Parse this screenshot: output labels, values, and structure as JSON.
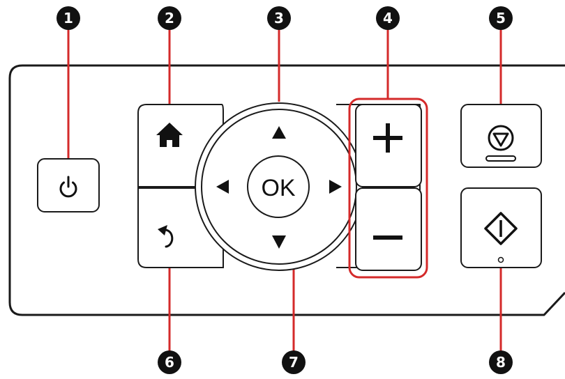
{
  "diagram": {
    "colors": {
      "callout_line": "#d42a2a",
      "panel_stroke": "#1a1a1a",
      "badge_fill": "#111111",
      "badge_text": "#ffffff"
    },
    "buttons": {
      "power": {
        "icon": "power-icon"
      },
      "home": {
        "icon": "home-icon"
      },
      "back": {
        "icon": "back-arrow-icon"
      },
      "ok": {
        "label": "OK"
      },
      "arrow_up": {
        "icon": "arrow-up-icon"
      },
      "arrow_down": {
        "icon": "arrow-down-icon"
      },
      "arrow_left": {
        "icon": "arrow-left-icon"
      },
      "arrow_right": {
        "icon": "arrow-right-icon"
      },
      "plus": {
        "icon": "plus-icon"
      },
      "minus": {
        "icon": "minus-icon"
      },
      "stop": {
        "icon": "stop-icon"
      },
      "start": {
        "icon": "start-icon"
      }
    },
    "callouts": [
      {
        "label": "1",
        "target": "power button"
      },
      {
        "label": "2",
        "target": "home button"
      },
      {
        "label": "3",
        "target": "arrow buttons"
      },
      {
        "label": "4",
        "target": "plus and minus buttons"
      },
      {
        "label": "5",
        "target": "stop button"
      },
      {
        "label": "6",
        "target": "back button"
      },
      {
        "label": "7",
        "target": "OK button"
      },
      {
        "label": "8",
        "target": "start button"
      }
    ]
  }
}
